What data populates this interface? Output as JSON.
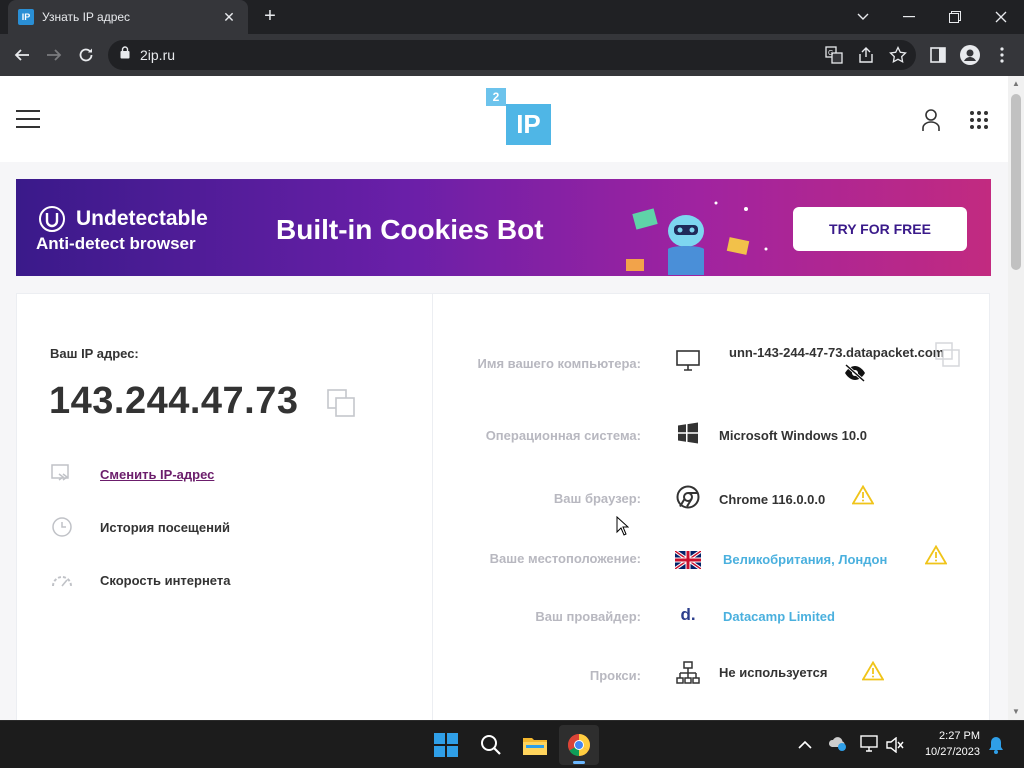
{
  "browser": {
    "tab_title": "Узнать IP адрес",
    "favicon_text": "IP",
    "url": "2ip.ru"
  },
  "site": {
    "logo_small": "2",
    "logo_big": "IP"
  },
  "banner": {
    "brand": "Undetectable",
    "subtitle": "Anti-detect browser",
    "title": "Built-in Cookies Bot",
    "cta": "TRY FOR FREE"
  },
  "ip_panel": {
    "label": "Ваш IP адрес:",
    "ip": "143.244.47.73",
    "menu": [
      {
        "label": "Сменить IP-адрес",
        "icon": "change-ip-icon"
      },
      {
        "label": "История посещений",
        "icon": "history-icon"
      },
      {
        "label": "Скорость интернета",
        "icon": "speedometer-icon"
      }
    ]
  },
  "info": [
    {
      "label": "Имя вашего компьютера:",
      "value": "unn-143-244-47-73.datapacket.com",
      "icon": "monitor-icon"
    },
    {
      "label": "Операционная система:",
      "value": "Microsoft Windows 10.0",
      "icon": "windows-icon"
    },
    {
      "label": "Ваш браузер:",
      "value": "Chrome 116.0.0.0",
      "icon": "chrome-icon",
      "warning": true
    },
    {
      "label": "Ваше местоположение:",
      "value": "Великобритания, Лондон",
      "icon": "uk-flag-icon",
      "warning": true,
      "link": true
    },
    {
      "label": "Ваш провайдер:",
      "value": "Datacamp Limited",
      "icon": "provider-icon",
      "icon_text": "d.",
      "link": true
    },
    {
      "label": "Прокси:",
      "value": "Не используется",
      "icon": "network-icon",
      "warning": true
    }
  ],
  "taskbar": {
    "time": "2:27 PM",
    "date": "10/27/2023"
  },
  "colors": {
    "accent": "#4fb6e6",
    "link_purple": "#6b1d6b",
    "warning": "#f0c419"
  }
}
